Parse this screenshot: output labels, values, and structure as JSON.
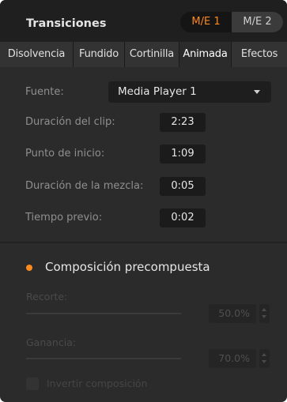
{
  "header": {
    "title": "Transiciones",
    "me_tabs": [
      {
        "label": "M/E 1",
        "active": true
      },
      {
        "label": "M/E 2",
        "active": false
      }
    ]
  },
  "tabs": [
    {
      "label": "Disolvencia",
      "active": false
    },
    {
      "label": "Fundido",
      "active": false
    },
    {
      "label": "Cortinilla",
      "active": false
    },
    {
      "label": "Animada",
      "active": true
    },
    {
      "label": "Efectos",
      "active": false
    }
  ],
  "source": {
    "label": "Fuente:",
    "value": "Media Player 1"
  },
  "fields": [
    {
      "label": "Duración del clip:",
      "value": "2:23"
    },
    {
      "label": "Punto de inicio:",
      "value": "1:09"
    },
    {
      "label": "Duración de la mezcla:",
      "value": "0:05"
    },
    {
      "label": "Tiempo previo:",
      "value": "0:02"
    }
  ],
  "precomposite": {
    "label": "Composición precompuesta",
    "selected": true
  },
  "clip": {
    "label": "Recorte:",
    "value": "50.0%",
    "percent": 50.0
  },
  "gain": {
    "label": "Ganancia:",
    "value": "70.0%",
    "percent": 70.0
  },
  "invert": {
    "label": "Invertir composición",
    "checked": false
  },
  "colors": {
    "accent": "#ff8a1d",
    "panel": "#2b2b2b",
    "header": "#1f1f1f"
  }
}
